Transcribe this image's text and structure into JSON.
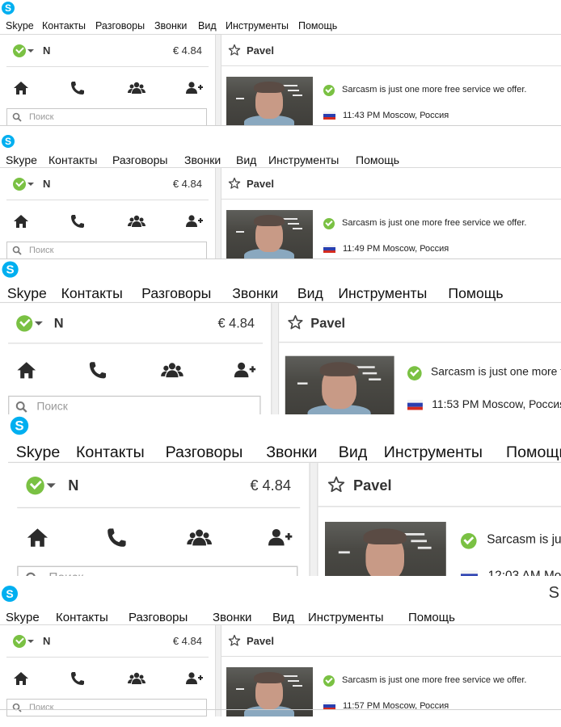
{
  "menu": {
    "app_title": "S",
    "items": [
      "Skype",
      "Контакты",
      "Разговоры",
      "Звонки",
      "Вид",
      "Инструменты",
      "Помощь"
    ]
  },
  "user": {
    "name": "N",
    "balance": "€ 4.84"
  },
  "search": {
    "placeholder": "Поиск"
  },
  "contact": {
    "name": "Pavel",
    "mood": "Sarcasm is just one more free service we offer.",
    "location": "Moscow, Россия"
  },
  "snapshots": [
    {
      "time": "11:43 PM",
      "show_title": false
    },
    {
      "time": "11:49 PM",
      "show_title": false
    },
    {
      "time": "11:53 PM",
      "show_title": false
    },
    {
      "time": "12:03 AM",
      "show_title": false
    },
    {
      "time": "11:57 PM",
      "show_title": true
    }
  ],
  "colors": {
    "skype_blue": "#00aff0",
    "status_online": "#7ac143"
  }
}
